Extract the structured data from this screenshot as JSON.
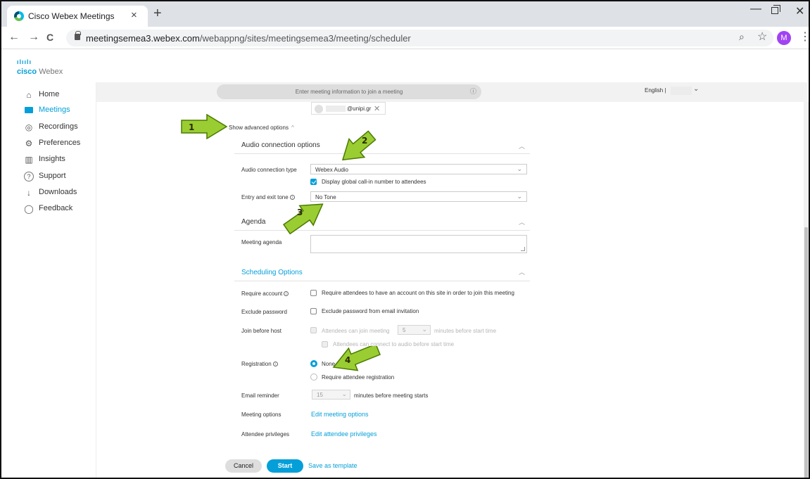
{
  "browser": {
    "tab_title": "Cisco Webex Meetings",
    "tab_close": "×",
    "new_tab": "+",
    "url_domain": "meetingsemea3.webex.com",
    "url_path": "/webappng/sites/meetingsemea3/meeting/scheduler",
    "avatar_letter": "M",
    "win_min": "—",
    "win_close": "✕",
    "back": "←",
    "forward": "→",
    "reload": "C",
    "zoom_icon": "⌕",
    "star_icon": "☆",
    "menu_icon": "⋮"
  },
  "brand": {
    "logo_bars": "ılıılı",
    "cisco": "cisco",
    "webex": "Webex"
  },
  "sidebar": {
    "items": [
      {
        "label": "Home",
        "icon": "home-icon",
        "glyph": "⌂"
      },
      {
        "label": "Meetings",
        "icon": "meetings-icon",
        "glyph": ""
      },
      {
        "label": "Recordings",
        "icon": "recordings-icon",
        "glyph": "◎"
      },
      {
        "label": "Preferences",
        "icon": "gear-icon",
        "glyph": "⚙"
      },
      {
        "label": "Insights",
        "icon": "insights-icon",
        "glyph": "▥"
      },
      {
        "label": "Support",
        "icon": "support-icon",
        "glyph": "?"
      },
      {
        "label": "Downloads",
        "icon": "download-icon",
        "glyph": "↓"
      },
      {
        "label": "Feedback",
        "icon": "feedback-icon",
        "glyph": "◯"
      }
    ]
  },
  "header": {
    "join_placeholder": "Enter meeting information to join a meeting",
    "join_info": "ⓘ",
    "language": "English |"
  },
  "attendee": {
    "email": "@unipi.gr",
    "remove": "✕"
  },
  "advanced": {
    "label": "Show advanced options",
    "caret": "^"
  },
  "audio": {
    "section_title": "Audio connection options",
    "type_label": "Audio connection type",
    "type_value": "Webex Audio",
    "display_callin_label": "Display global call-in number to attendees",
    "display_callin_checked": true,
    "tone_label": "Entry and exit tone",
    "tone_value": "No Tone"
  },
  "agenda": {
    "section_title": "Agenda",
    "meeting_agenda_label": "Meeting agenda"
  },
  "scheduling": {
    "section_title": "Scheduling Options",
    "require_account_label": "Require account",
    "require_account_text": "Require attendees to have an account on this site in order to join this meeting",
    "exclude_password_label": "Exclude password",
    "exclude_password_text": "Exclude password from email invitation",
    "join_before_host_label": "Join before host",
    "join_before_host_text_pre": "Attendees can join meeting",
    "join_before_host_minutes": "5",
    "join_before_host_text_post": "minutes before start time",
    "audio_before_text": "Attendees can connect to audio before start time",
    "registration_label": "Registration",
    "registration_options": [
      "None",
      "Require attendee registration"
    ],
    "registration_selected": "None",
    "email_reminder_label": "Email reminder",
    "email_reminder_value": "15",
    "email_reminder_text": "minutes before meeting starts",
    "meeting_options_label": "Meeting options",
    "meeting_options_link": "Edit meeting options",
    "attendee_privileges_label": "Attendee privileges",
    "attendee_privileges_link": "Edit attendee privileges"
  },
  "actions": {
    "cancel": "Cancel",
    "start": "Start",
    "save_template": "Save as template"
  },
  "annotations": [
    "1",
    "2",
    "3",
    "4"
  ],
  "colors": {
    "accent": "#049fd9",
    "arrow_fill": "#9acd32",
    "arrow_stroke": "#4a7a00"
  }
}
